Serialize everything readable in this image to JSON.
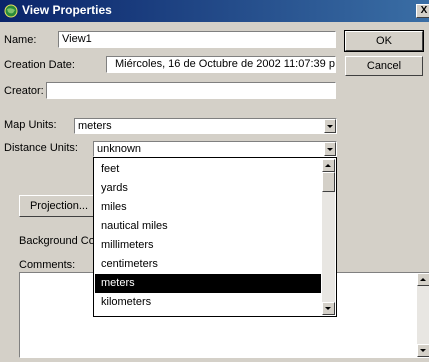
{
  "window": {
    "title": "View Properties",
    "close_glyph": "X"
  },
  "form": {
    "name_label": "Name:",
    "name_value": "View1",
    "creation_date_label": "Creation Date:",
    "creation_date_value": "Miércoles, 16 de Octubre de 2002 11:07:39 p.",
    "creator_label": "Creator:",
    "creator_value": "",
    "map_units_label": "Map Units:",
    "map_units_value": "meters",
    "distance_units_label": "Distance Units:",
    "distance_units_value": "unknown",
    "projection_button": "Projection...",
    "background_color_label": "Background Col",
    "comments_label": "Comments:",
    "comments_value": ""
  },
  "buttons": {
    "ok": "OK",
    "cancel": "Cancel"
  },
  "dropdown": {
    "items": [
      "feet",
      "yards",
      "miles",
      "nautical miles",
      "millimeters",
      "centimeters",
      "meters",
      "kilometers"
    ],
    "selected": "meters"
  },
  "colors": {
    "titlebar_start": "#0a246a",
    "titlebar_end": "#3a6ea5",
    "face": "#d4d0c8",
    "selection": "#000000"
  }
}
